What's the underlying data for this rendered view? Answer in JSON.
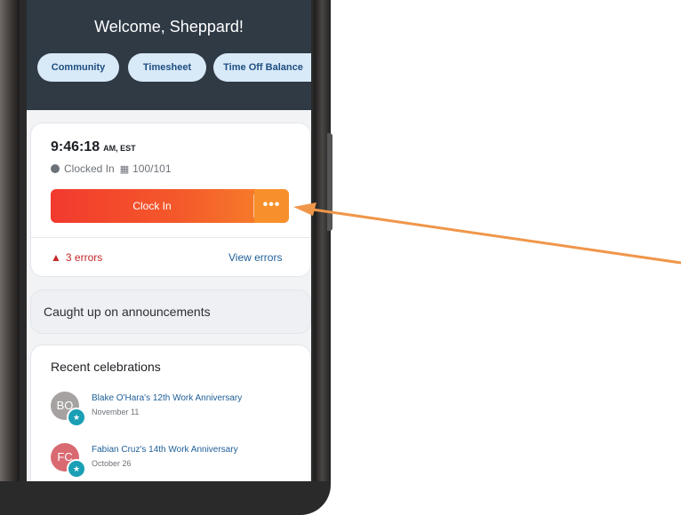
{
  "header": {
    "welcome": "Welcome, Sheppard!",
    "pills": [
      "Community",
      "Timesheet",
      "Time Off Balance"
    ]
  },
  "clock_card": {
    "time": "9:46:18",
    "time_suffix": "AM, EST",
    "status": "Clocked In",
    "location": "100/101",
    "clock_button_label": "Clock In",
    "more_button_label": "•••",
    "errors_label": "3 errors",
    "view_errors_label": "View errors"
  },
  "announcements": {
    "text": "Caught up on announcements"
  },
  "celebrations": {
    "title": "Recent celebrations",
    "items": [
      {
        "initials": "BO",
        "title": "Blake O'Hara's 12th Work Anniversary",
        "date": "November 11",
        "avatar_color": "#a6a2a2"
      },
      {
        "initials": "FC",
        "title": "Fabian Cruz's 14th Work Anniversary",
        "date": "October 26",
        "avatar_color": "#d96a72"
      }
    ]
  },
  "colors": {
    "header_bg": "#2f3a45",
    "pill_bg": "#d8e9f8",
    "clock_gradient_start": "#f23a2e",
    "clock_gradient_end": "#f7882a",
    "error_red": "#c62828",
    "link_blue": "#1f5f99",
    "arrow": "#f0964a"
  },
  "icons": {
    "status": "clock-status-icon",
    "location": "building-icon",
    "error": "warning-icon",
    "badge": "celebration-badge-icon"
  }
}
